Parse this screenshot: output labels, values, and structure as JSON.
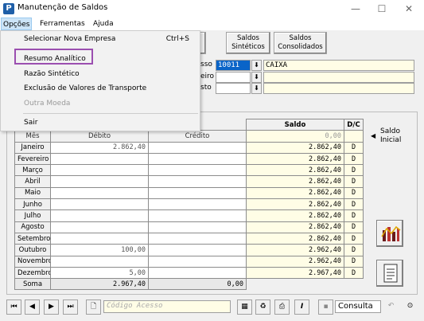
{
  "window": {
    "title": "Manutenção de Saldos",
    "app_icon": "P",
    "minimize": "—",
    "maximize": "☐",
    "close": "✕"
  },
  "menu": {
    "items": [
      "Opções",
      "Ferramentas",
      "Ajuda"
    ]
  },
  "dropdown": {
    "items": [
      {
        "label": "Selecionar Nova Empresa",
        "shortcut": "Ctrl+S"
      },
      {
        "label": "Resumo Analítico",
        "shortcut": ""
      },
      {
        "label": "Razão Sintético",
        "shortcut": ""
      },
      {
        "label": "Exclusão de Valores de Transporte",
        "shortcut": ""
      },
      {
        "label": "Outra Moeda",
        "shortcut": ""
      },
      {
        "label": "Sair",
        "shortcut": ""
      }
    ]
  },
  "buttons": {
    "saldos_sinteticos": [
      "Saldos",
      "Sintéticos"
    ],
    "saldos_consolidados": [
      "Saldos",
      "Consolidados"
    ]
  },
  "fields": {
    "label_1": "sso",
    "label_2": "eiro",
    "label_3": "sto",
    "conta_code": "10011",
    "conta_name": "CAIXA"
  },
  "grid": {
    "headers": {
      "saldo": "Saldo",
      "dc": "D/C",
      "mes": "Mês",
      "debito": "Débito",
      "credito": "Crédito"
    },
    "saldo_anterior": "0,00",
    "rows": [
      {
        "mes": "Janeiro",
        "debito": "2.862,40",
        "credito": "",
        "saldo": "2.862,40",
        "dc": "D"
      },
      {
        "mes": "Fevereiro",
        "debito": "",
        "credito": "",
        "saldo": "2.862,40",
        "dc": "D"
      },
      {
        "mes": "Março",
        "debito": "",
        "credito": "",
        "saldo": "2.862,40",
        "dc": "D"
      },
      {
        "mes": "Abril",
        "debito": "",
        "credito": "",
        "saldo": "2.862,40",
        "dc": "D"
      },
      {
        "mes": "Maio",
        "debito": "",
        "credito": "",
        "saldo": "2.862,40",
        "dc": "D"
      },
      {
        "mes": "Junho",
        "debito": "",
        "credito": "",
        "saldo": "2.862,40",
        "dc": "D"
      },
      {
        "mes": "Julho",
        "debito": "",
        "credito": "",
        "saldo": "2.862,40",
        "dc": "D"
      },
      {
        "mes": "Agosto",
        "debito": "",
        "credito": "",
        "saldo": "2.862,40",
        "dc": "D"
      },
      {
        "mes": "Setembro",
        "debito": "",
        "credito": "",
        "saldo": "2.862,40",
        "dc": "D"
      },
      {
        "mes": "Outubro",
        "debito": "100,00",
        "credito": "",
        "saldo": "2.962,40",
        "dc": "D"
      },
      {
        "mes": "Novembro",
        "debito": "",
        "credito": "",
        "saldo": "2.962,40",
        "dc": "D"
      },
      {
        "mes": "Dezembro",
        "debito": "5,00",
        "credito": "",
        "saldo": "2.967,40",
        "dc": "D"
      }
    ],
    "soma": {
      "label": "Soma",
      "debito": "2.967,40",
      "credito": "0,00"
    }
  },
  "side": {
    "saldo_inicial": [
      "Saldo",
      "Inicial"
    ],
    "arrow": "◀"
  },
  "toolbar": {
    "codigo_placeholder": "Código Acesso",
    "mode": "Consulta"
  }
}
